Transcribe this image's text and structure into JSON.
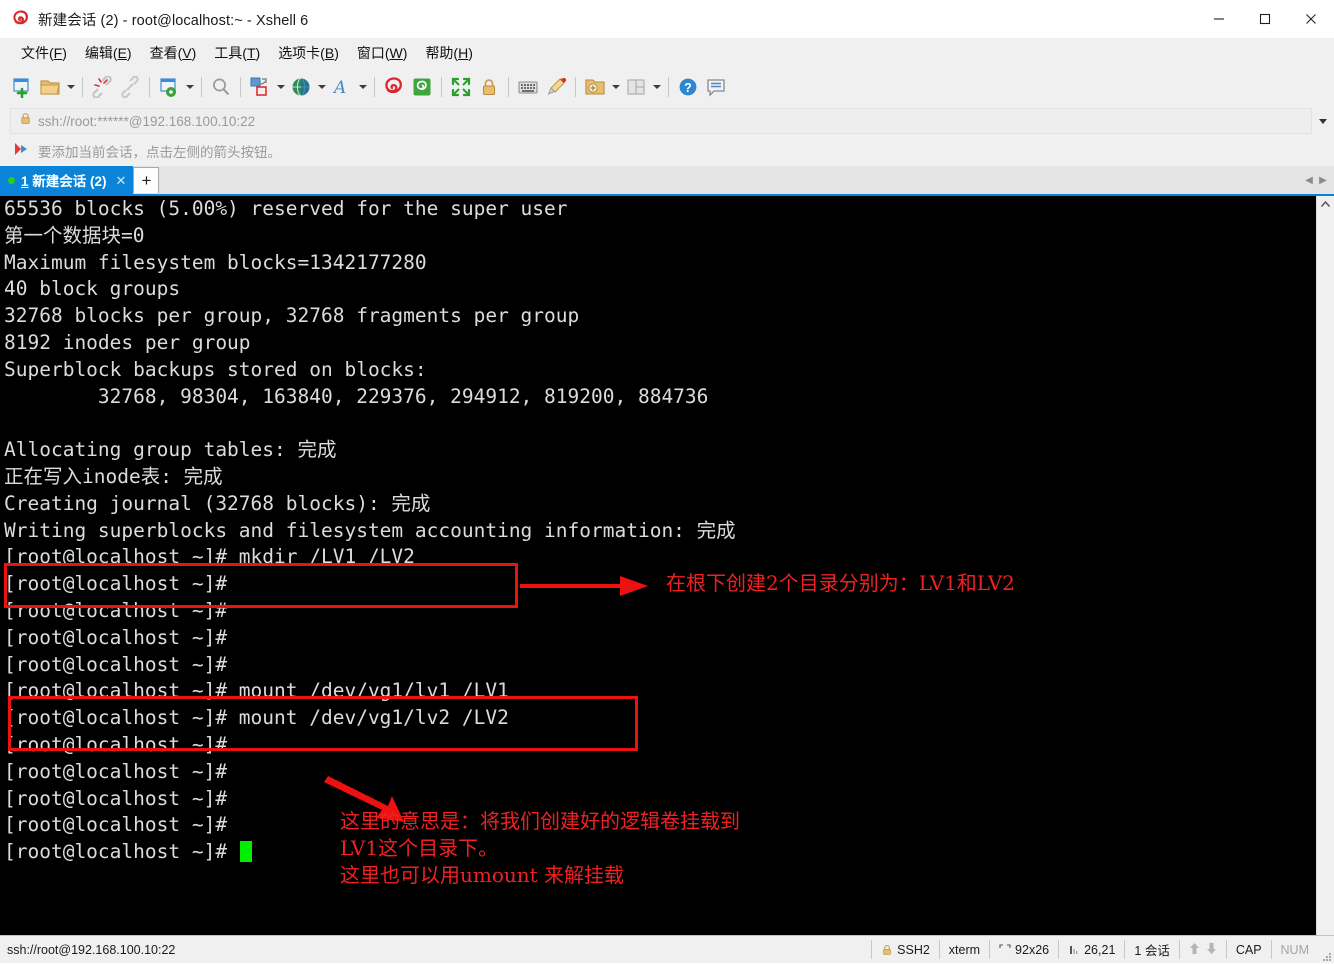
{
  "window": {
    "title": "新建会话 (2) - root@localhost:~ - Xshell 6",
    "icon": "xshell-logo-icon",
    "minimize": "—",
    "maximize": "□",
    "close": "✕"
  },
  "menubar": {
    "items": [
      {
        "label": "文件(F)",
        "pre": "文件(",
        "key": "F",
        "post": ")"
      },
      {
        "label": "编辑(E)",
        "pre": "编辑(",
        "key": "E",
        "post": ")"
      },
      {
        "label": "查看(V)",
        "pre": "查看(",
        "key": "V",
        "post": ")"
      },
      {
        "label": "工具(T)",
        "pre": "工具(",
        "key": "T",
        "post": ")"
      },
      {
        "label": "选项卡(B)",
        "pre": "选项卡(",
        "key": "B",
        "post": ")"
      },
      {
        "label": "窗口(W)",
        "pre": "窗口(",
        "key": "W",
        "post": ")"
      },
      {
        "label": "帮助(H)",
        "pre": "帮助(",
        "key": "H",
        "post": ")"
      }
    ]
  },
  "toolbar": {
    "buttons": [
      "new-session-icon",
      "open-session-icon",
      "open-session-dropdown",
      "disconnect-icon",
      "reconnect-icon",
      "session-properties-icon",
      "session-properties-dropdown",
      "find-icon",
      "file-transfer-icon",
      "file-transfer-dropdown",
      "browser-icon",
      "browser-dropdown",
      "font-icon",
      "font-dropdown",
      "xshell-icon",
      "xftp-icon",
      "fullscreen-icon",
      "lock-icon",
      "compose-bar-icon",
      "highlight-icon",
      "new-folder-icon",
      "new-folder-dropdown",
      "split-view-icon",
      "split-view-dropdown",
      "help-icon",
      "chat-icon"
    ]
  },
  "address": {
    "lock_icon": "lock-icon",
    "value": "ssh://root:******@192.168.100.10:22",
    "dropdown_icon": "chevron-down-icon"
  },
  "hint": {
    "icon": "red-arrow-icon",
    "text": "要添加当前会话，点击左侧的箭头按钮。"
  },
  "tabs": {
    "items": [
      {
        "index": "1",
        "title": "新建会话 (2)",
        "close": "✕",
        "active": true
      }
    ],
    "new_tab_label": "+",
    "nav_prev": "◀",
    "nav_next": "▶"
  },
  "terminal": {
    "lines": [
      "65536 blocks (5.00%) reserved for the super user",
      "第一个数据块=0",
      "Maximum filesystem blocks=1342177280",
      "40 block groups",
      "32768 blocks per group, 32768 fragments per group",
      "8192 inodes per group",
      "Superblock backups stored on blocks:",
      "        32768, 98304, 163840, 229376, 294912, 819200, 884736",
      "",
      "Allocating group tables: 完成",
      "正在写入inode表: 完成",
      "Creating journal (32768 blocks): 完成",
      "Writing superblocks and filesystem accounting information: 完成",
      "[root@localhost ~]# mkdir /LV1 /LV2",
      "[root@localhost ~]#",
      "[root@localhost ~]#",
      "[root@localhost ~]#",
      "[root@localhost ~]#",
      "[root@localhost ~]# mount /dev/vg1/lv1 /LV1",
      "[root@localhost ~]# mount /dev/vg1/lv2 /LV2",
      "[root@localhost ~]#",
      "[root@localhost ~]#",
      "[root@localhost ~]#",
      "[root@localhost ~]#",
      "[root@localhost ~]#"
    ],
    "prompt_last": "[root@localhost ~]# ",
    "cursor_color": "#00ee00",
    "bg": "#000000",
    "fg": "#dcdcdc"
  },
  "annotations": {
    "color": "#ee2222",
    "note1": "在根下创建2个目录分别为：LV1和LV2",
    "note2_line1": "这里的意思是：将我们创建好的逻辑卷挂载到",
    "note2_line2": "LV1这个目录下。",
    "note2_line3": "这里也可以用umount 来解挂载"
  },
  "statusbar": {
    "connection": "ssh://root@192.168.100.10:22",
    "protocol_icon": "lock-icon",
    "protocol": "SSH2",
    "terminal_type": "xterm",
    "size_icon": "screen-size-icon",
    "size": "92x26",
    "cursor_icon": "cursor-position-icon",
    "cursor_pos": "26,21",
    "sessions": "1 会话",
    "up_icon": "arrow-up-icon",
    "down_icon": "arrow-down-icon",
    "cap": "CAP",
    "num": "NUM"
  }
}
